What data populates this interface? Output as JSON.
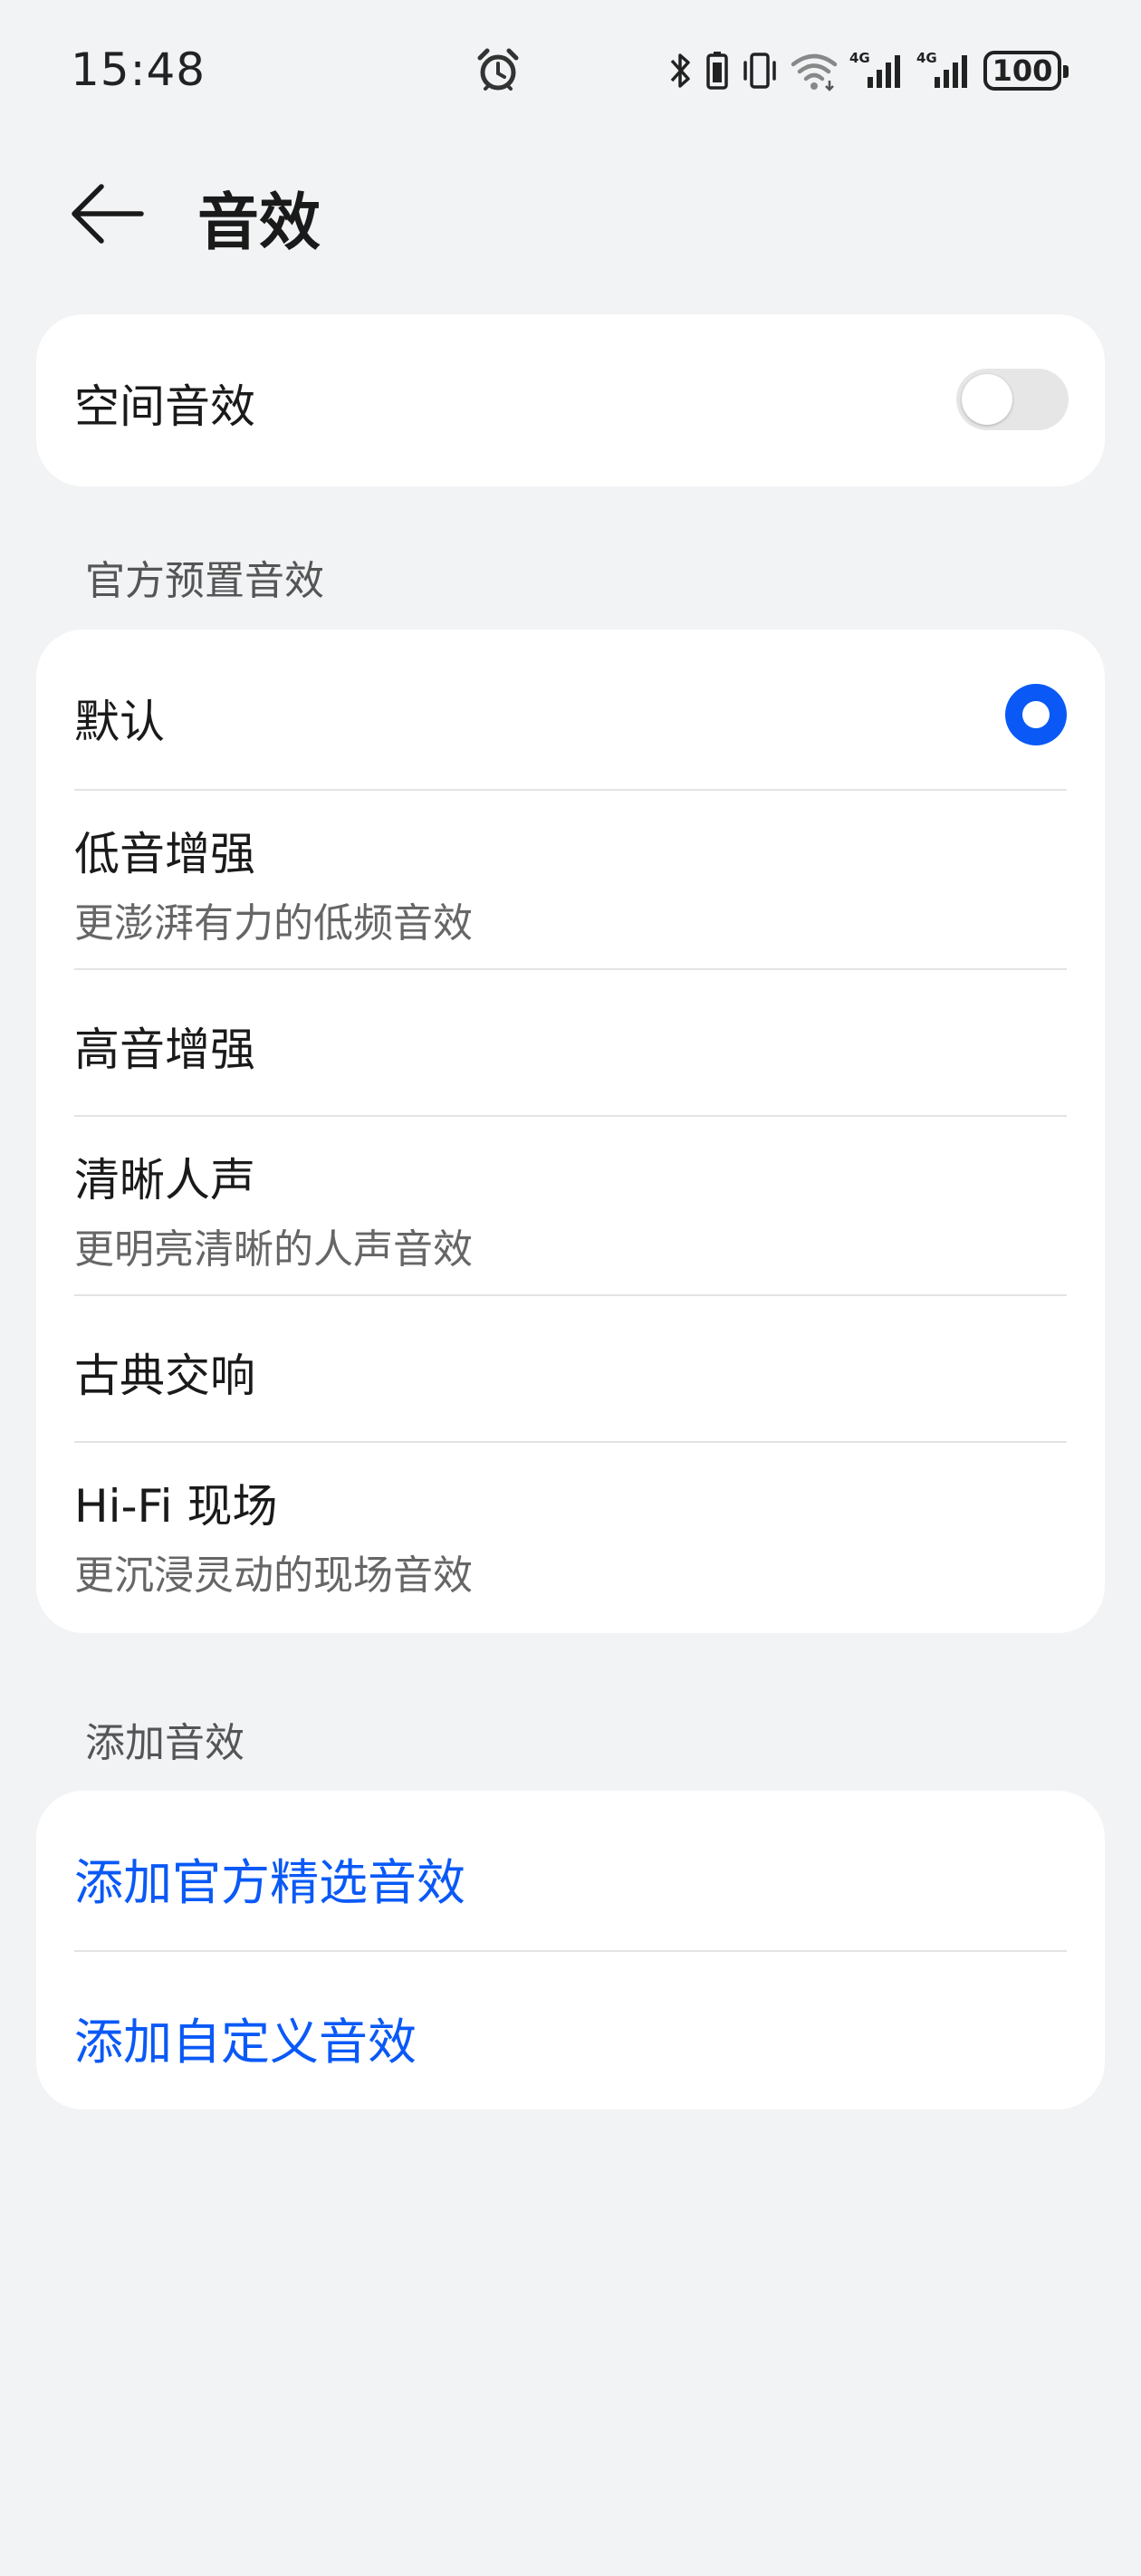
{
  "status_bar": {
    "time": "15:48",
    "battery": "100",
    "icons": [
      "alarm-icon",
      "bluetooth-icon",
      "battery-saver-icon",
      "vibrate-icon",
      "wifi-icon",
      "signal-4g-icon",
      "signal-4g-icon"
    ]
  },
  "header": {
    "title": "音效"
  },
  "spatial": {
    "label": "空间音效",
    "enabled": false
  },
  "presets": {
    "section_label": "官方预置音效",
    "selected_index": 0,
    "items": [
      {
        "title": "默认",
        "subtitle": ""
      },
      {
        "title": "低音增强",
        "subtitle": "更澎湃有力的低频音效"
      },
      {
        "title": "高音增强",
        "subtitle": ""
      },
      {
        "title": "清晰人声",
        "subtitle": "更明亮清晰的人声音效"
      },
      {
        "title": "古典交响",
        "subtitle": ""
      },
      {
        "title": "Hi-Fi 现场",
        "subtitle": "更沉浸灵动的现场音效"
      }
    ]
  },
  "add": {
    "section_label": "添加音效",
    "items": [
      {
        "label": "添加官方精选音效"
      },
      {
        "label": "添加自定义音效"
      }
    ]
  },
  "colors": {
    "accent": "#0a59f7",
    "background": "#f1f3f5",
    "card": "#ffffff"
  }
}
